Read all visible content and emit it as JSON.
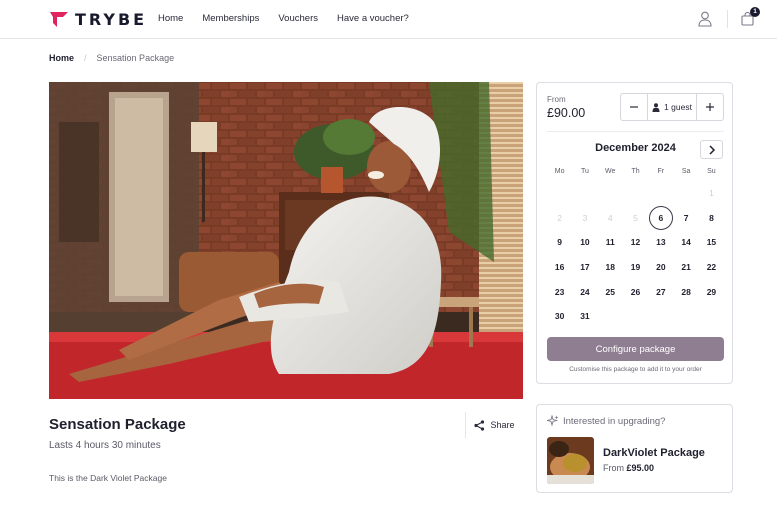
{
  "header": {
    "brand": "TRYBE",
    "nav": [
      "Home",
      "Memberships",
      "Vouchers",
      "Have a voucher?"
    ],
    "cart_count": "1"
  },
  "breadcrumb": {
    "home": "Home",
    "current": "Sensation Package"
  },
  "package": {
    "title": "Sensation Package",
    "duration": "Lasts 4 hours 30 minutes",
    "description": "This is the Dark Violet Package",
    "share_label": "Share"
  },
  "booking": {
    "from_label": "From",
    "price": "£90.00",
    "guest_label": "1 guest",
    "month": "December 2024",
    "weekdays": [
      "Mo",
      "Tu",
      "We",
      "Th",
      "Fr",
      "Sa",
      "Su"
    ],
    "days": [
      {
        "d": "",
        "state": "empty"
      },
      {
        "d": "",
        "state": "empty"
      },
      {
        "d": "",
        "state": "empty"
      },
      {
        "d": "",
        "state": "empty"
      },
      {
        "d": "",
        "state": "empty"
      },
      {
        "d": "",
        "state": "empty"
      },
      {
        "d": "1",
        "state": "disabled"
      },
      {
        "d": "2",
        "state": "disabled"
      },
      {
        "d": "3",
        "state": "disabled"
      },
      {
        "d": "4",
        "state": "disabled"
      },
      {
        "d": "5",
        "state": "disabled"
      },
      {
        "d": "6",
        "state": "selected"
      },
      {
        "d": "7",
        "state": "available"
      },
      {
        "d": "8",
        "state": "available"
      },
      {
        "d": "9",
        "state": "available"
      },
      {
        "d": "10",
        "state": "available"
      },
      {
        "d": "11",
        "state": "available"
      },
      {
        "d": "12",
        "state": "available"
      },
      {
        "d": "13",
        "state": "available"
      },
      {
        "d": "14",
        "state": "available"
      },
      {
        "d": "15",
        "state": "available"
      },
      {
        "d": "16",
        "state": "available"
      },
      {
        "d": "17",
        "state": "available"
      },
      {
        "d": "18",
        "state": "available"
      },
      {
        "d": "19",
        "state": "available"
      },
      {
        "d": "20",
        "state": "available"
      },
      {
        "d": "21",
        "state": "available"
      },
      {
        "d": "22",
        "state": "available"
      },
      {
        "d": "23",
        "state": "available"
      },
      {
        "d": "24",
        "state": "available"
      },
      {
        "d": "25",
        "state": "available"
      },
      {
        "d": "26",
        "state": "available"
      },
      {
        "d": "27",
        "state": "available"
      },
      {
        "d": "28",
        "state": "available"
      },
      {
        "d": "29",
        "state": "available"
      },
      {
        "d": "30",
        "state": "available"
      },
      {
        "d": "31",
        "state": "available"
      }
    ],
    "configure_label": "Configure package",
    "configure_hint": "Customise this package to add it to your order"
  },
  "upgrade": {
    "title": "Interested in upgrading?",
    "name": "DarkViolet Package",
    "from_label": "From",
    "price": "£95.00"
  },
  "colors": {
    "brand_red": "#e0245e",
    "button_mauve": "#8f7e91"
  }
}
